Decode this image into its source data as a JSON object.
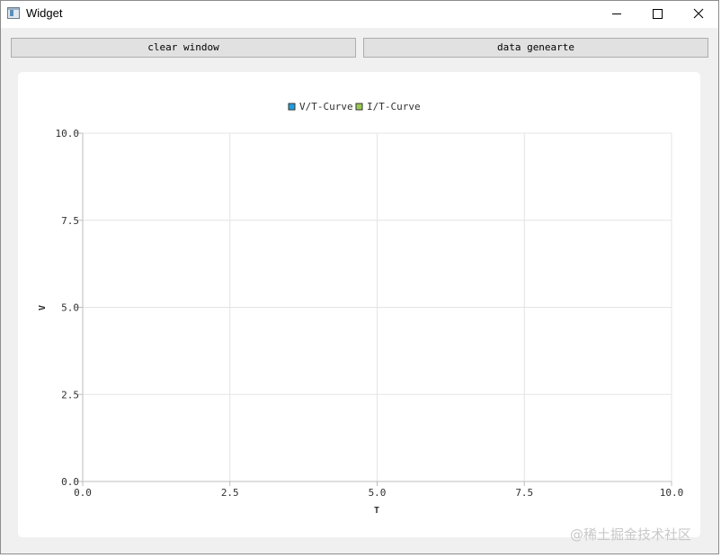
{
  "window": {
    "title": "Widget"
  },
  "toolbar": {
    "clear_label": "clear window",
    "generate_label": "data genearte"
  },
  "chart_data": {
    "type": "line",
    "legend": [
      "V/T-Curve",
      "I/T-Curve"
    ],
    "legend_colors": [
      "#209fdf",
      "#99ca53"
    ],
    "legend_placement": "top",
    "xlabel": "T",
    "ylabel": "V",
    "xlim": [
      0,
      10
    ],
    "ylim": [
      0,
      10
    ],
    "xticks": [
      "0.0",
      "2.5",
      "5.0",
      "7.5",
      "10.0"
    ],
    "yticks": [
      "0.0",
      "2.5",
      "5.0",
      "7.5",
      "10.0"
    ],
    "grid": true,
    "series": [
      {
        "name": "V/T-Curve",
        "x": [],
        "y": []
      },
      {
        "name": "I/T-Curve",
        "x": [],
        "y": []
      }
    ]
  },
  "watermark": "@稀土掘金技术社区"
}
